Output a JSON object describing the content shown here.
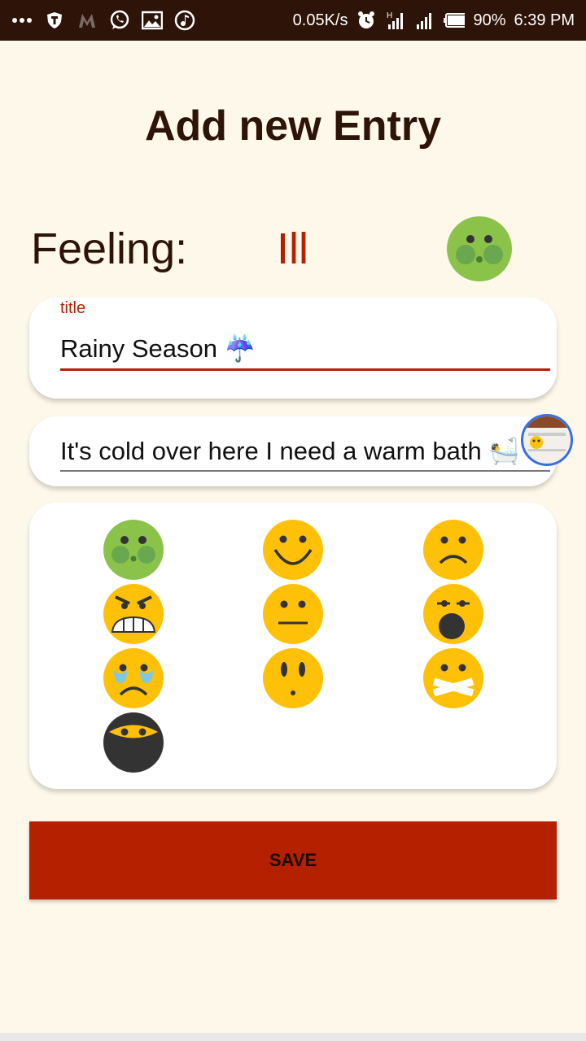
{
  "status_bar": {
    "speed": "0.05K/s",
    "battery": "90%",
    "time": "6:39 PM"
  },
  "page": {
    "title": "Add new Entry"
  },
  "feeling": {
    "label": "Feeling:",
    "value": "Ill"
  },
  "form": {
    "title_label": "title",
    "title_value": "Rainy Season ☔",
    "description_value": "It's cold over here I need a warm bath 🛀"
  },
  "emojis": [
    {
      "name": "ill",
      "color": "#8bc34a"
    },
    {
      "name": "happy",
      "color": "#ffc107"
    },
    {
      "name": "sad",
      "color": "#ffc107"
    },
    {
      "name": "angry",
      "color": "#ffc107"
    },
    {
      "name": "neutral",
      "color": "#ffc107"
    },
    {
      "name": "shocked",
      "color": "#ffc107"
    },
    {
      "name": "crying",
      "color": "#ffc107"
    },
    {
      "name": "surprised",
      "color": "#ffc107"
    },
    {
      "name": "silenced",
      "color": "#ffc107"
    },
    {
      "name": "ninja",
      "color": "#333333"
    }
  ],
  "save_button": {
    "label": "SAVE"
  },
  "colors": {
    "accent": "#b42000",
    "background": "#fef8ea",
    "text_dark": "#2d1308"
  }
}
